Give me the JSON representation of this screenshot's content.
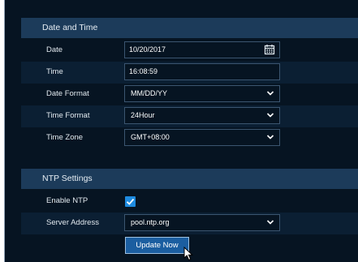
{
  "date_time": {
    "title": "Date and Time",
    "date_label": "Date",
    "date_value": "10/20/2017",
    "time_label": "Time",
    "time_value": "16:08:59",
    "date_format_label": "Date Format",
    "date_format_value": "MM/DD/YY",
    "time_format_label": "Time Format",
    "time_format_value": "24Hour",
    "time_zone_label": "Time Zone",
    "time_zone_value": "GMT+08:00"
  },
  "ntp": {
    "title": "NTP Settings",
    "enable_label": "Enable NTP",
    "enable_checked": true,
    "server_label": "Server Address",
    "server_value": "pool.ntp.org",
    "update_button": "Update Now"
  },
  "icons": {
    "calendar": "calendar-icon",
    "dropdown": "chevron-down-icon",
    "check": "checkmark-icon",
    "cursor": "mouse-pointer-icon"
  },
  "colors": {
    "background": "#061422",
    "header": "#1c3b5a",
    "accent": "#1e8be0",
    "button": "#1b5ea0"
  }
}
